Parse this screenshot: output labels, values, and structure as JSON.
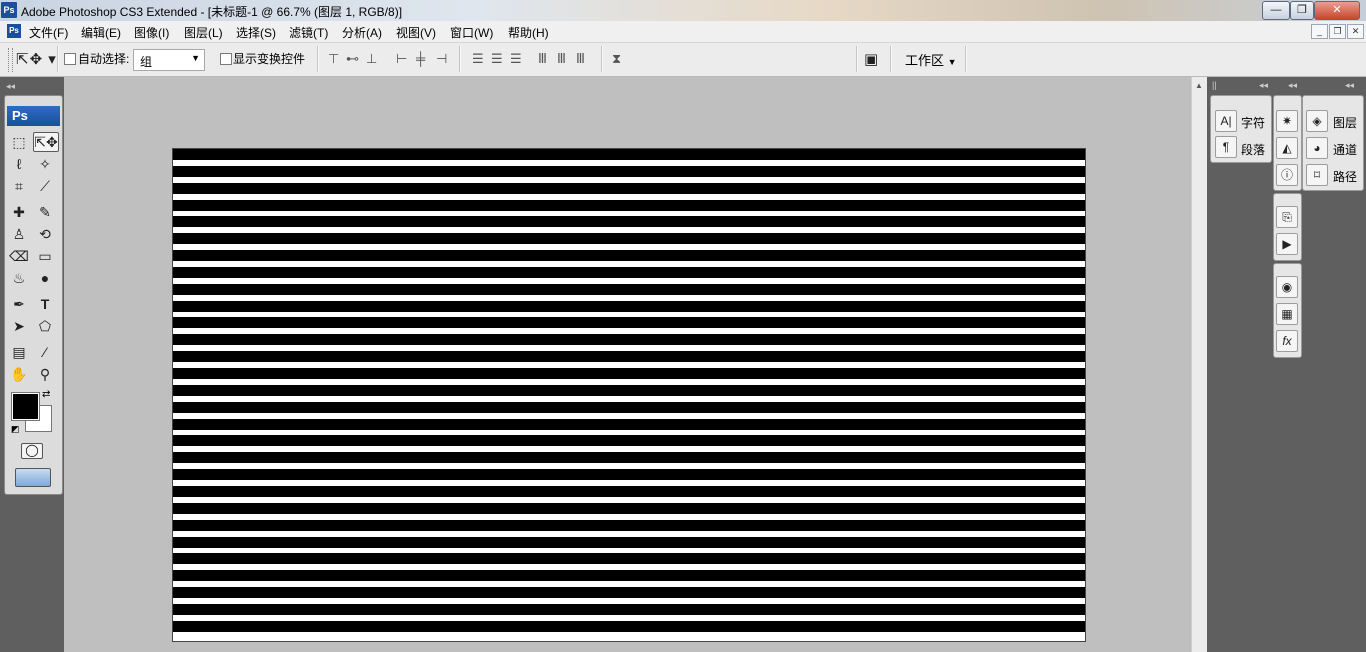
{
  "window": {
    "title": "Adobe Photoshop CS3 Extended - [未标题-1 @ 66.7% (图层 1, RGB/8)]",
    "logo": "Ps"
  },
  "menu": [
    "文件(F)",
    "编辑(E)",
    "图像(I)",
    "图层(L)",
    "选择(S)",
    "滤镜(T)",
    "分析(A)",
    "视图(V)",
    "窗口(W)",
    "帮助(H)"
  ],
  "options": {
    "auto_select_label": "自动选择:",
    "auto_select_value": "组",
    "show_transform_label": "显示变换控件",
    "workspace_label": "工作区"
  },
  "toolbox": {
    "logo": "Ps"
  },
  "panels": {
    "group1": [
      "字符",
      "段落"
    ],
    "group3": [
      "图层",
      "通道",
      "路径"
    ]
  },
  "canvas": {
    "stripe_color": "#000000",
    "background_color": "#ffffff"
  }
}
